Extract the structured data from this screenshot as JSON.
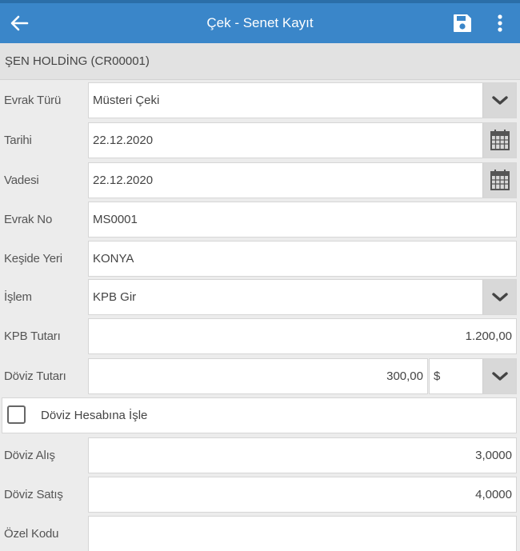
{
  "header": {
    "title": "Çek - Senet Kayıt",
    "accent": "#3a86c9"
  },
  "company": "ŞEN HOLDİNG (CR00001)",
  "form": {
    "evrak_turu": {
      "label": "Evrak Türü",
      "value": "Müsteri Çeki",
      "icon": "chevron-down-icon"
    },
    "tarihi": {
      "label": "Tarihi",
      "value": "22.12.2020",
      "icon": "calendar-icon"
    },
    "vadesi": {
      "label": "Vadesi",
      "value": "22.12.2020",
      "icon": "calendar-icon"
    },
    "evrak_no": {
      "label": "Evrak No",
      "value": "MS0001"
    },
    "keside_yeri": {
      "label": "Keşide Yeri",
      "value": "KONYA"
    },
    "islem": {
      "label": "İşlem",
      "value": "KPB Gir",
      "icon": "chevron-down-icon"
    },
    "kpb_tutari": {
      "label": "KPB Tutarı",
      "value": "1.200,00"
    },
    "doviz_tutari": {
      "label": "Döviz Tutarı",
      "value": "300,00",
      "currency": "$"
    },
    "doviz_hesabi": {
      "label": "Döviz Hesabına İşle",
      "checked": false
    },
    "doviz_alis": {
      "label": "Döviz Alış",
      "value": "3,0000"
    },
    "doviz_satis": {
      "label": "Döviz Satış",
      "value": "4,0000"
    },
    "ozel_kodu": {
      "label": "Özel Kodu",
      "value": ""
    }
  }
}
